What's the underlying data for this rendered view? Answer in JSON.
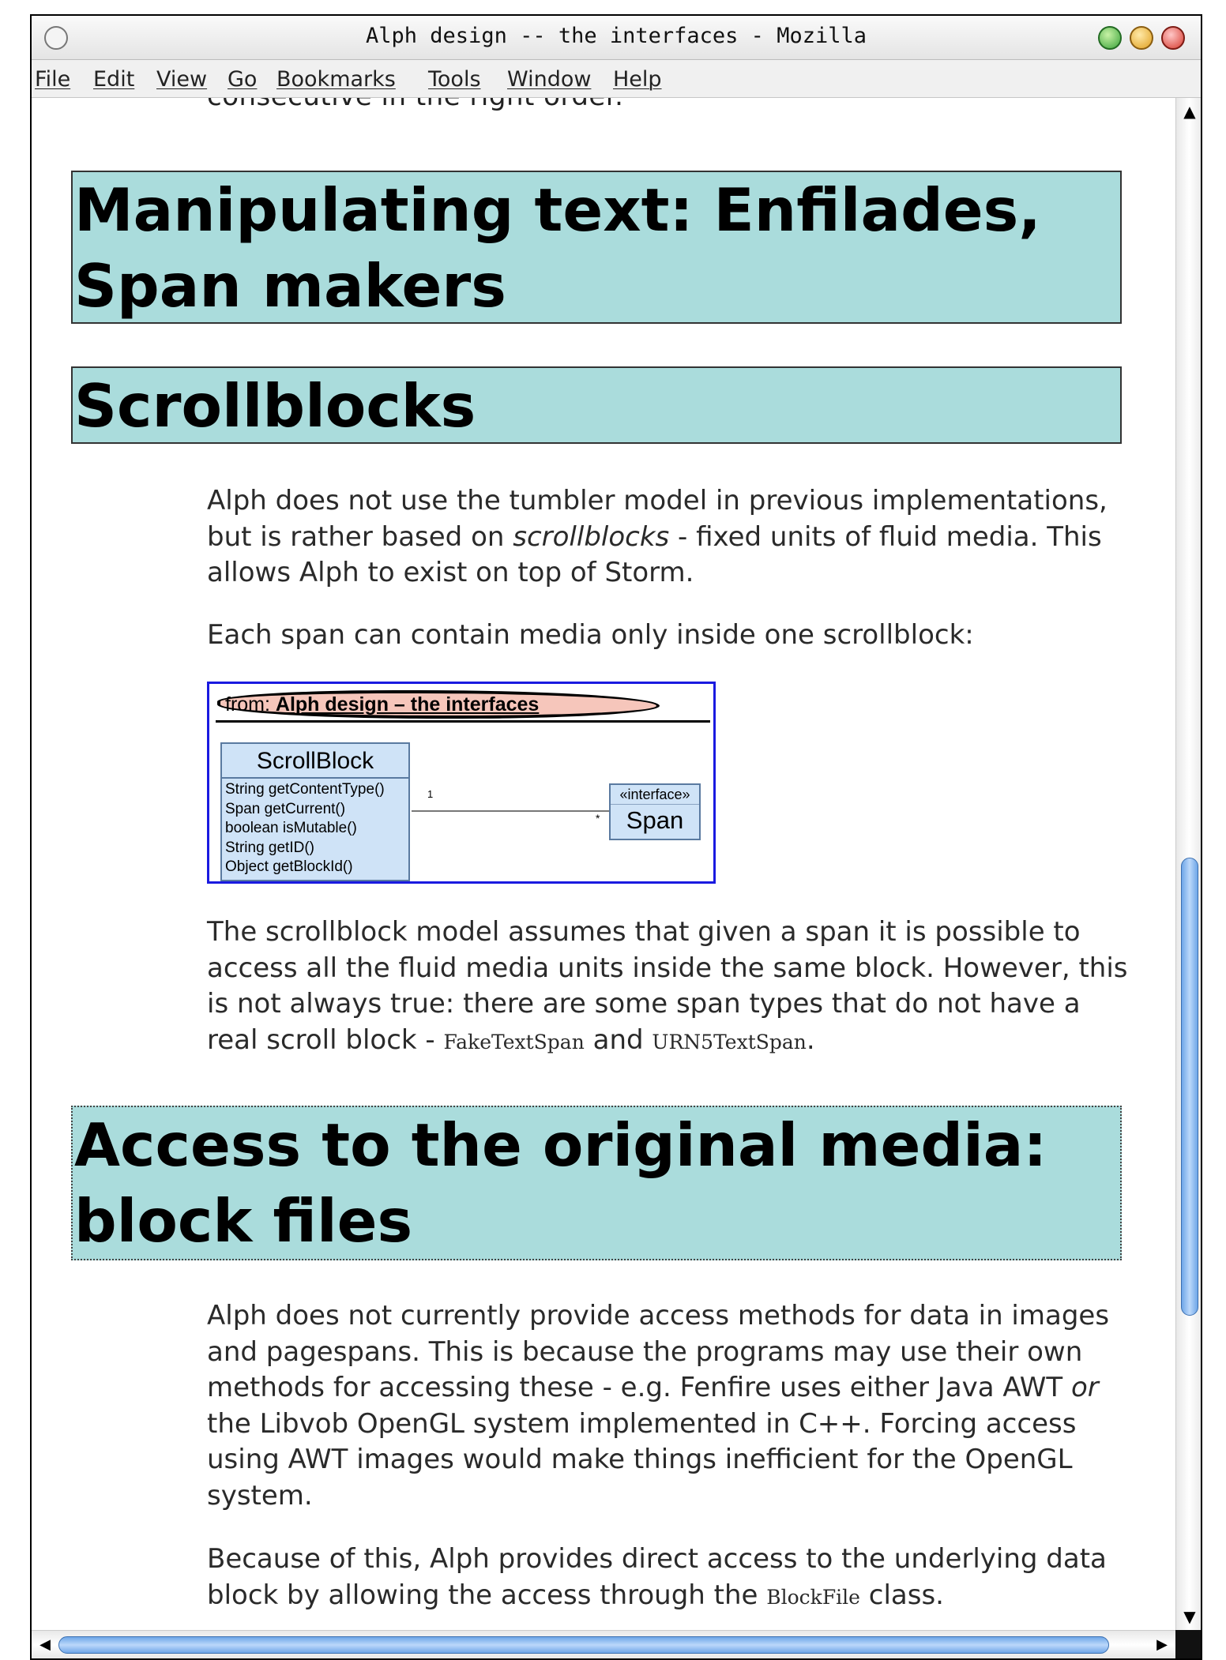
{
  "window": {
    "title": "Alph design -- the interfaces - Mozilla"
  },
  "menu": {
    "file": "File",
    "edit": "Edit",
    "view": "View",
    "go": "Go",
    "bookmarks": "Bookmarks",
    "tools": "Tools",
    "window": "Window",
    "help": "Help"
  },
  "content": {
    "partial_line": "consecutive in the right order.",
    "heading1": "Manipulating text: Enfilades, Span makers",
    "heading2": "Scrollblocks",
    "para1": {
      "before": "Alph does not use the tumbler model in previous implementations, but is rather based on ",
      "em": "scrollblocks",
      "after": " - fixed units of fluid media. This allows Alph to exist on top of Storm."
    },
    "para2": "Each span can contain media only inside one scrollblock:",
    "diagram": {
      "from_prefix": "from: ",
      "from_title": "Alph design – the interfaces",
      "class_name": "ScrollBlock",
      "methods": [
        "String getContentType()",
        "Span getCurrent()",
        "boolean isMutable()",
        "String getID()",
        "Object getBlockId()"
      ],
      "multiplicity_source": "1",
      "multiplicity_target": "*",
      "interface_stereotype": "«interface»",
      "interface_name": "Span"
    },
    "para3": {
      "before": "The scrollblock model assumes that given a span it is possible to access all the fluid media units inside the same block. However, this is not always true: there are some span types that do not have a real scroll block - ",
      "code1": "FakeTextSpan",
      "mid": " and ",
      "code2": "URN5TextSpan",
      "after": "."
    },
    "heading3": "Access to the original media: block files",
    "para4": {
      "before": "Alph does not currently provide access methods for data in images and pagespans. This is because the programs may use their own methods for accessing these - e.g. Fenfire uses either Java AWT ",
      "em": "or",
      "after": " the Libvob OpenGL system implemented in C++. Forcing access using AWT images would make things inefficient for the OpenGL system."
    },
    "para5": {
      "before": "Because of this, Alph provides direct access to the underlying data block by allowing the access through the ",
      "code": "BlockFile",
      "after": " class."
    }
  },
  "scrollbars": {
    "up_icon": "▲",
    "down_icon": "▼",
    "left_icon": "◀",
    "right_icon": "▶"
  }
}
